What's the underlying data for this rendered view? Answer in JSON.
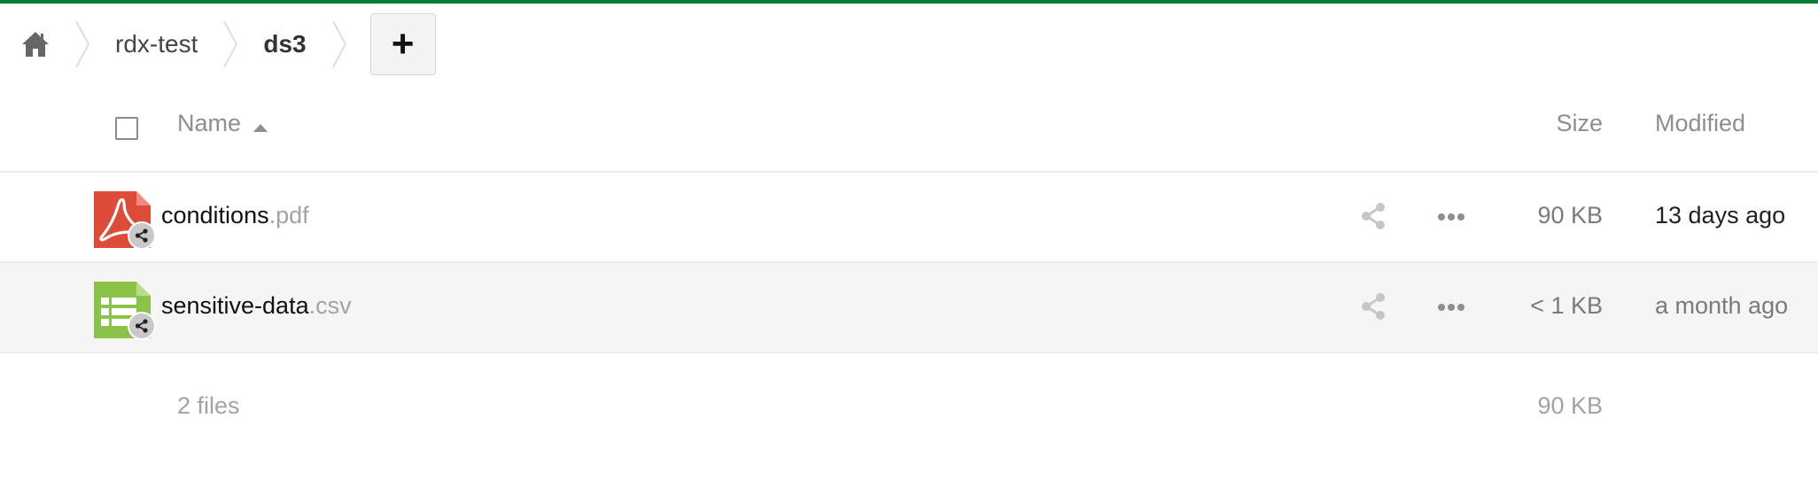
{
  "colors": {
    "accent_bar": "#0a7a3a",
    "pdf_icon": "#dd4b39",
    "csv_icon": "#8bc34a",
    "selected_row_bg": "#f5f5f5"
  },
  "breadcrumb": {
    "home_icon": "home-icon",
    "items": [
      {
        "label": "rdx-test"
      },
      {
        "label": "ds3"
      }
    ],
    "add_label": "+"
  },
  "table": {
    "headers": {
      "name": "Name",
      "size": "Size",
      "modified": "Modified"
    },
    "sort": "name-ascending",
    "rows": [
      {
        "name": "conditions",
        "ext": ".pdf",
        "icon": "pdf-file-icon",
        "shared": true,
        "size": "90 KB",
        "modified": "13 days ago"
      },
      {
        "name": "sensitive-data",
        "ext": ".csv",
        "icon": "spreadsheet-file-icon",
        "shared": true,
        "size": "< 1 KB",
        "modified": "a month ago"
      }
    ],
    "summary": {
      "count": "2 files",
      "size": "90 KB"
    }
  }
}
